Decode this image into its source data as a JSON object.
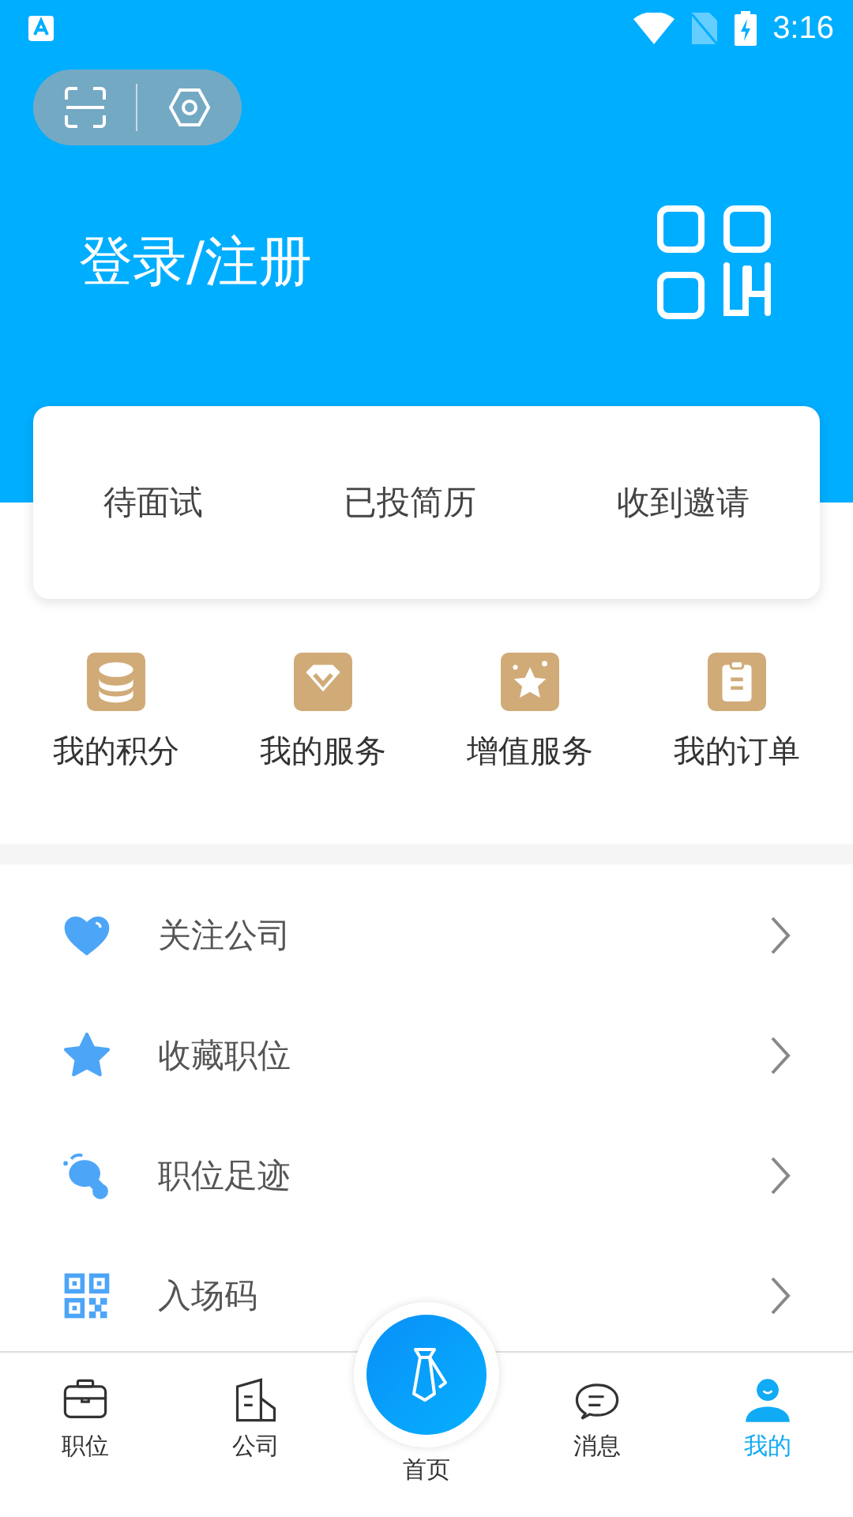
{
  "status_bar": {
    "time": "3:16"
  },
  "header": {
    "title": "登录/注册"
  },
  "stats": [
    {
      "label": "待面试"
    },
    {
      "label": "已投简历"
    },
    {
      "label": "收到邀请"
    }
  ],
  "shortcuts": [
    {
      "kind": "coins",
      "label": "我的积分"
    },
    {
      "kind": "diamond",
      "label": "我的服务"
    },
    {
      "kind": "star",
      "label": "增值服务"
    },
    {
      "kind": "clipboard",
      "label": "我的订单"
    }
  ],
  "menu": [
    {
      "kind": "heart",
      "label": "关注公司"
    },
    {
      "kind": "star",
      "label": "收藏职位"
    },
    {
      "kind": "footprint",
      "label": "职位足迹"
    },
    {
      "kind": "qr",
      "label": "入场码"
    }
  ],
  "bottom_nav": [
    {
      "kind": "briefcase",
      "label": "职位",
      "selected": false
    },
    {
      "kind": "building",
      "label": "公司",
      "selected": false
    },
    {
      "kind": "home",
      "label": "首页",
      "selected": false
    },
    {
      "kind": "chat",
      "label": "消息",
      "selected": false
    },
    {
      "kind": "person",
      "label": "我的",
      "selected": true
    }
  ]
}
